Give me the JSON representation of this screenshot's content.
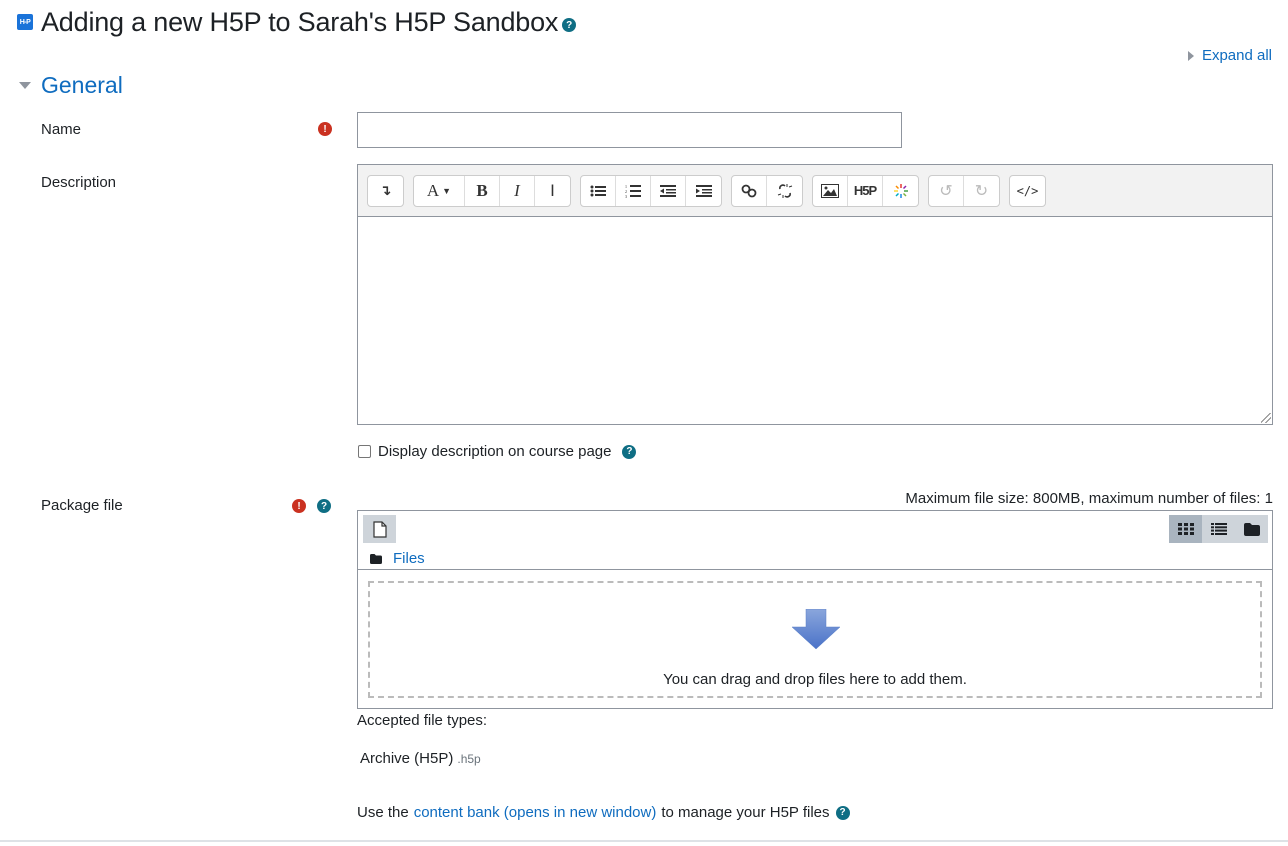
{
  "header": {
    "logo_text": "H-P",
    "title": "Adding a new H5P to Sarah's H5P Sandbox",
    "expand_all": "Expand all"
  },
  "section": {
    "title": "General"
  },
  "fields": {
    "name": {
      "label": "Name",
      "value": "",
      "required": true
    },
    "description": {
      "label": "Description",
      "value": "",
      "toolbar": [
        [
          "collapse"
        ],
        [
          "font-style",
          "bold",
          "italic",
          "clear-formatting"
        ],
        [
          "unordered-list",
          "ordered-list",
          "outdent",
          "indent"
        ],
        [
          "link",
          "unlink"
        ],
        [
          "image",
          "h5p",
          "media"
        ],
        [
          "undo",
          "redo"
        ],
        [
          "html"
        ]
      ],
      "h5p_button_label": "H5P"
    },
    "display_description": {
      "label": "Display description on course page",
      "checked": false
    },
    "package_file": {
      "label": "Package file",
      "required": true,
      "max_size_text": "Maximum file size: 800MB, maximum number of files: 1",
      "path_label": "Files",
      "drop_text": "You can drag and drop files here to add them.",
      "accepted_label": "Accepted file types:",
      "accepted_types": [
        {
          "name": "Archive (H5P)",
          "ext": ".h5p"
        }
      ],
      "content_bank_prefix": "Use the",
      "content_bank_link": "content bank (opens in new window)",
      "content_bank_suffix": "to manage your H5P files"
    }
  },
  "colors": {
    "link": "#0f6cbf",
    "required": "#ca3120",
    "help": "#0f6e84"
  }
}
